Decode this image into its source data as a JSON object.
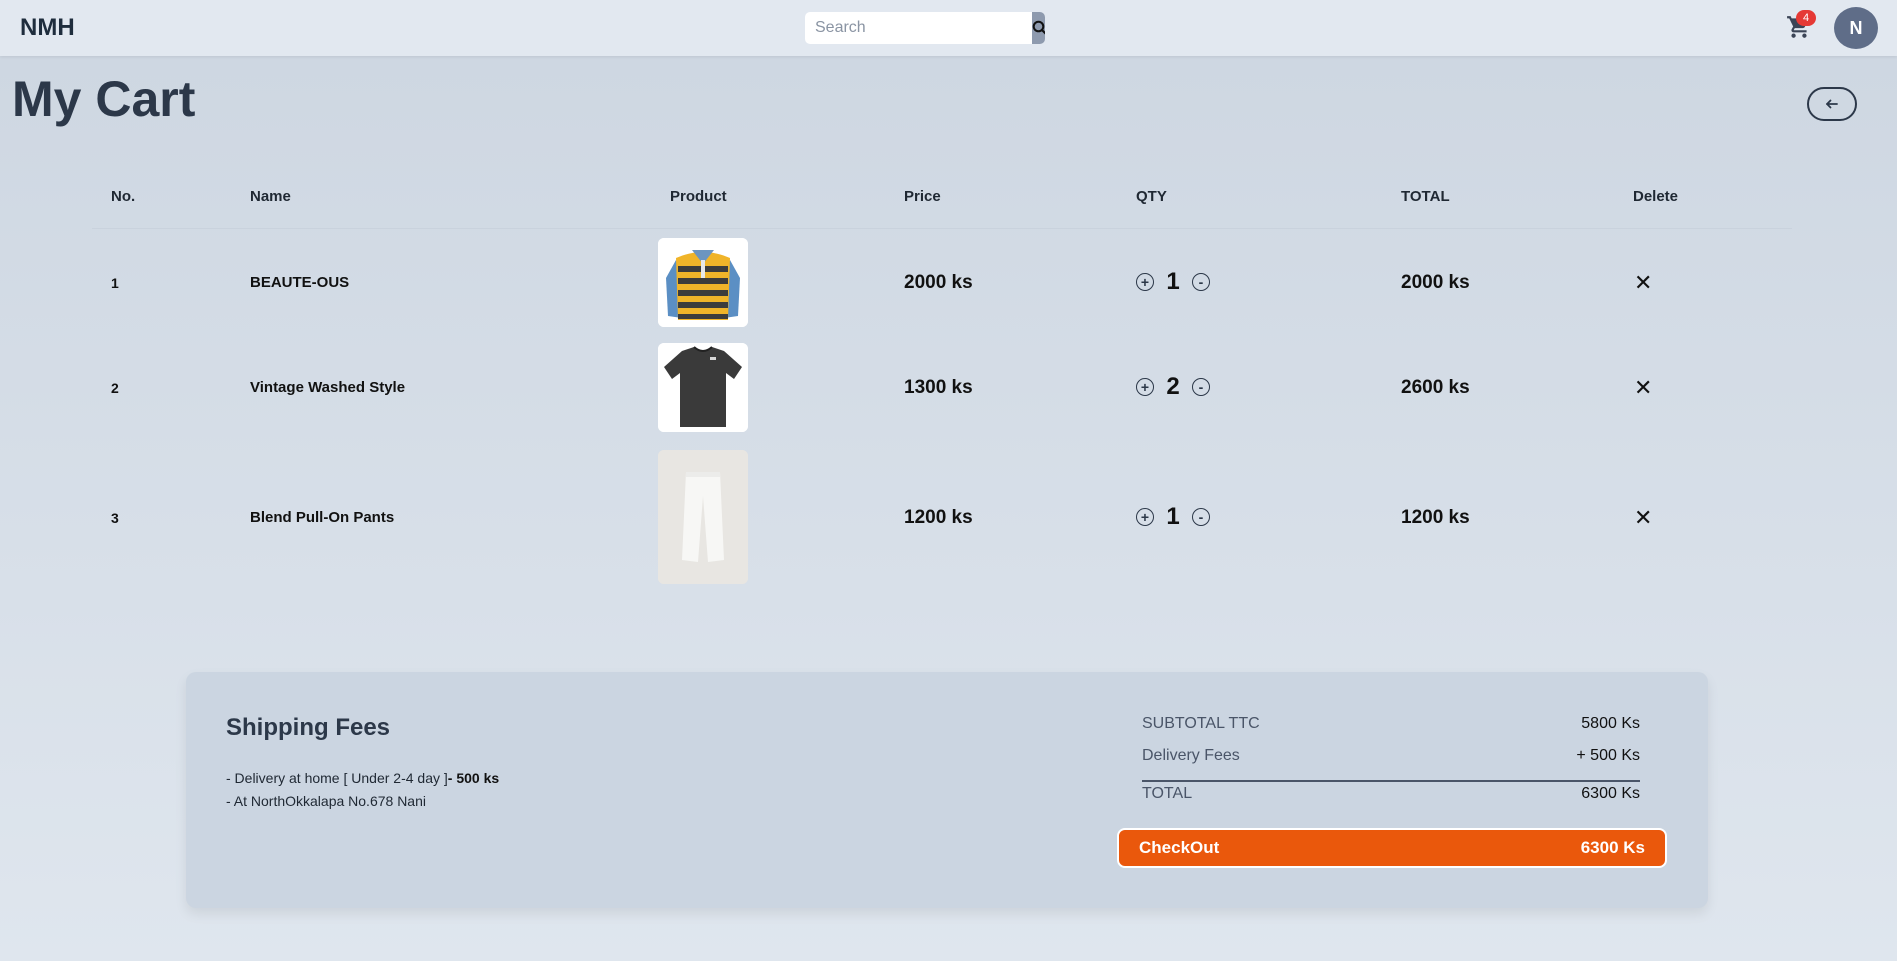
{
  "header": {
    "brand": "NMH",
    "search_placeholder": "Search",
    "cart_count": "4",
    "avatar_initial": "N"
  },
  "page": {
    "title": "My Cart"
  },
  "table": {
    "headers": {
      "no": "No.",
      "name": "Name",
      "product": "Product",
      "price": "Price",
      "qty": "QTY",
      "total": "TOTAL",
      "delete": "Delete"
    },
    "rows": [
      {
        "no": "1",
        "name": "BEAUTE-OUS",
        "price": "2000 ks",
        "qty": "1",
        "total": "2000 ks",
        "image": "striped-sweater-image"
      },
      {
        "no": "2",
        "name": "Vintage Washed Style",
        "price": "1300 ks",
        "qty": "2",
        "total": "2600 ks",
        "image": "black-tshirt-image"
      },
      {
        "no": "3",
        "name": "Blend Pull-On Pants",
        "price": "1200 ks",
        "qty": "1",
        "total": "1200 ks",
        "image": "white-pants-image"
      }
    ],
    "plus": "+",
    "minus": "-",
    "delete_symbol": "✕"
  },
  "summary": {
    "shipping_title": "Shipping Fees",
    "line1_text": "- Delivery at home [ Under 2-4 day ]",
    "line1_bold": "- 500 ks",
    "line2_text": "- At NorthOkkalapa No.678 Nani",
    "subtotal_label": "SUBTOTAL TTC",
    "subtotal_value": "5800 Ks",
    "delivery_label": "Delivery Fees",
    "delivery_value": "+ 500 Ks",
    "total_label": "TOTAL",
    "total_value": "6300 Ks",
    "checkout_label": "CheckOut",
    "checkout_value": "6300 Ks"
  },
  "colors": {
    "accent": "#ea580c",
    "badge": "#e53935",
    "avatar": "#5f6d88"
  }
}
